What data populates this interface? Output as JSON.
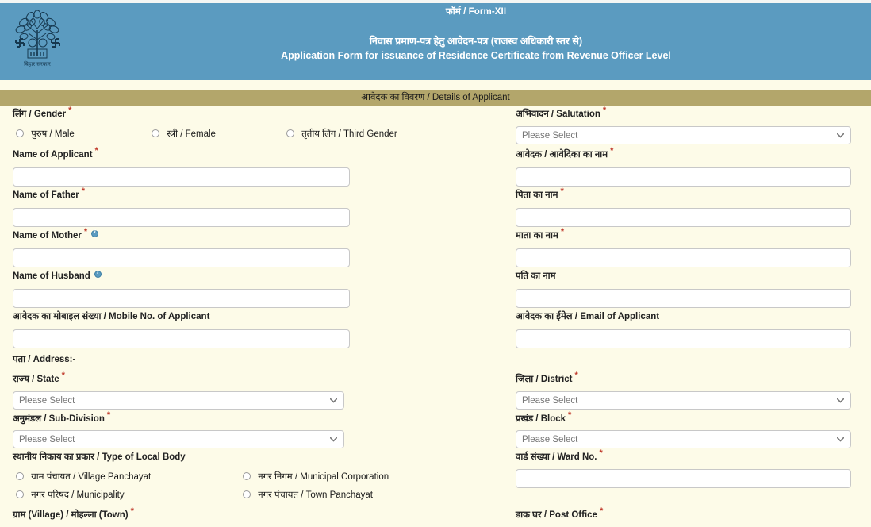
{
  "header": {
    "form_no": "फॉर्म / Form-XII",
    "title_hi": "निवास प्रमाण-पत्र हेतु आवेदन-पत्र (राजस्व अधिकारी स्तर से)",
    "title_en": "Application Form for issuance of  Residence Certificate from Revenue Officer Level",
    "emblem_caption": "बिहार सरकार",
    "bg_color": "#5b9bc0"
  },
  "section": {
    "title": "आवेदक का विवरण / Details of Applicant",
    "bg_color": "#b3a66b"
  },
  "page": {
    "background_color": "#fdfbe8",
    "required_marker_color": "#c0392b",
    "info_icon_color": "#5b9bc0"
  },
  "placeholders": {
    "please_select": "Please Select"
  },
  "fields": {
    "gender": {
      "label": "लिंग / Gender",
      "required": true,
      "options": [
        {
          "label": "पुरुष / Male",
          "checked": false
        },
        {
          "label": "स्त्री / Female",
          "checked": false
        },
        {
          "label": "तृतीय लिंग / Third Gender",
          "checked": false
        }
      ]
    },
    "salutation": {
      "label": "अभिवादन / Salutation",
      "required": true,
      "value": "Please Select"
    },
    "name_of_applicant_en": {
      "label": "Name of Applicant",
      "required": true,
      "value": ""
    },
    "name_of_applicant_hi": {
      "label": "आवेदक / आवेदिका का नाम",
      "required": true,
      "value": ""
    },
    "name_of_father_en": {
      "label": "Name of Father",
      "required": true,
      "value": ""
    },
    "name_of_father_hi": {
      "label": "पिता का नाम",
      "required": true,
      "value": ""
    },
    "name_of_mother_en": {
      "label": "Name of Mother",
      "required": true,
      "has_info": true,
      "value": ""
    },
    "name_of_mother_hi": {
      "label": "माता का नाम",
      "required": true,
      "value": ""
    },
    "name_of_husband_en": {
      "label": "Name of Husband",
      "required": false,
      "has_info": true,
      "value": ""
    },
    "name_of_husband_hi": {
      "label": "पति का नाम",
      "required": false,
      "value": ""
    },
    "mobile": {
      "label": "आवेदक का मोबाइल संख्या / Mobile No. of Applicant",
      "required": false,
      "value": ""
    },
    "email": {
      "label": "आवेदक का ईमेल / Email of Applicant",
      "required": false,
      "value": ""
    },
    "address_heading": "पता / Address:-",
    "state": {
      "label": "राज्य / State",
      "required": true,
      "value": "Please Select"
    },
    "district": {
      "label": "जिला / District",
      "required": true,
      "value": "Please Select"
    },
    "sub_division": {
      "label": "अनुमंडल / Sub-Division",
      "required": true,
      "value": "Please Select"
    },
    "block": {
      "label": "प्रखंड / Block",
      "required": true,
      "value": "Please Select"
    },
    "local_body": {
      "label": "स्थानीय निकाय का प्रकार / Type of Local Body",
      "required": false,
      "options": [
        {
          "label": "ग्राम पंचायत / Village Panchayat",
          "checked": false
        },
        {
          "label": "नगर निगम / Municipal Corporation",
          "checked": false
        },
        {
          "label": "नगर परिषद / Municipality",
          "checked": false
        },
        {
          "label": "नगर पंचायत / Town Panchayat",
          "checked": false
        }
      ]
    },
    "ward_no": {
      "label": "वार्ड संख्या / Ward No.",
      "required": true,
      "value": ""
    },
    "village_town": {
      "label": "ग्राम (Village) / मोहल्ला (Town)",
      "required": true
    },
    "post_office": {
      "label": "डाक घर / Post Office",
      "required": true
    }
  }
}
